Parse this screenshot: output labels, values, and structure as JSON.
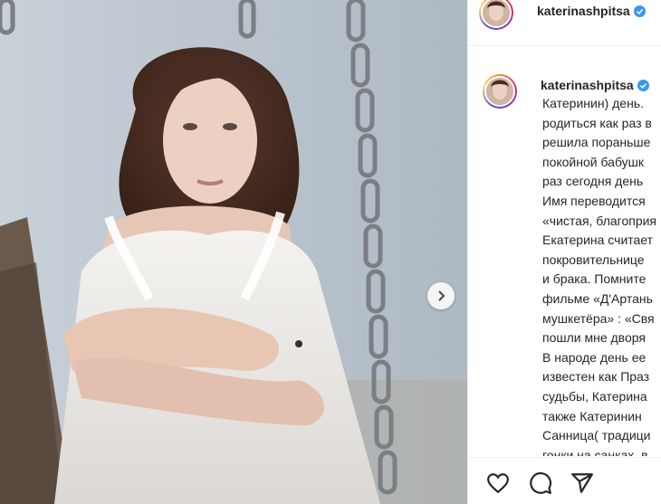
{
  "post": {
    "username": "katerinashpitsa",
    "verified": true
  },
  "caption": {
    "lines": [
      "Катеринин) день.",
      "родиться как раз в",
      "решила пораньше",
      "покойной бабушк",
      "раз сегодня день",
      "Имя переводится",
      "«чистая, благоприя",
      "Екатерина считает",
      "покровительнице",
      "и брака. Помните",
      "фильме «Д'Артань",
      "мушкетёра» : «Свя",
      "пошли мне дворя",
      "В народе день ее",
      "известен как Праз",
      "судьбы, Катерина",
      "также Катеринин",
      "Санница( традици",
      "гонки на санках, в"
    ]
  },
  "actions": {
    "like": "heart-icon",
    "comment": "comment-icon",
    "share": "share-icon"
  },
  "carousel": {
    "next": "chevron-right-icon"
  },
  "colors": {
    "verified": "#3897f0",
    "text": "#262626",
    "border": "#efefef"
  }
}
